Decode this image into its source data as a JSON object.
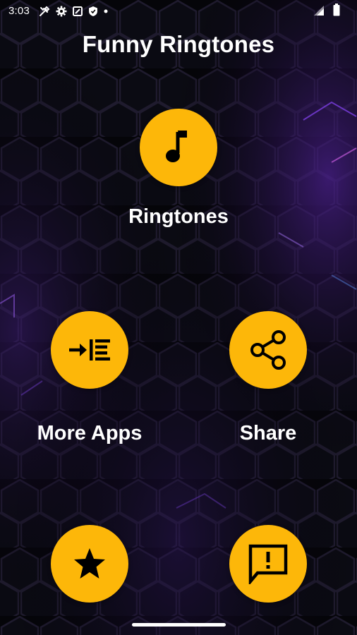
{
  "status_bar": {
    "time": "3:03",
    "icons": [
      "tools-icon",
      "gear-icon",
      "block-icon",
      "shield-icon",
      "dot-icon",
      "signal-icon",
      "battery-icon"
    ]
  },
  "header": {
    "title": "Funny Ringtones"
  },
  "menu": {
    "ringtones": {
      "label": "Ringtones",
      "icon": "music-note-icon"
    },
    "more_apps": {
      "label": "More Apps",
      "icon": "indent-list-icon"
    },
    "share": {
      "label": "Share",
      "icon": "share-icon"
    },
    "rate": {
      "icon": "star-icon"
    },
    "feedback": {
      "icon": "feedback-icon"
    }
  },
  "colors": {
    "accent": "#fdb709",
    "background": "#05050a",
    "text": "#ffffff",
    "hex_glow": "#6a2fd0"
  }
}
